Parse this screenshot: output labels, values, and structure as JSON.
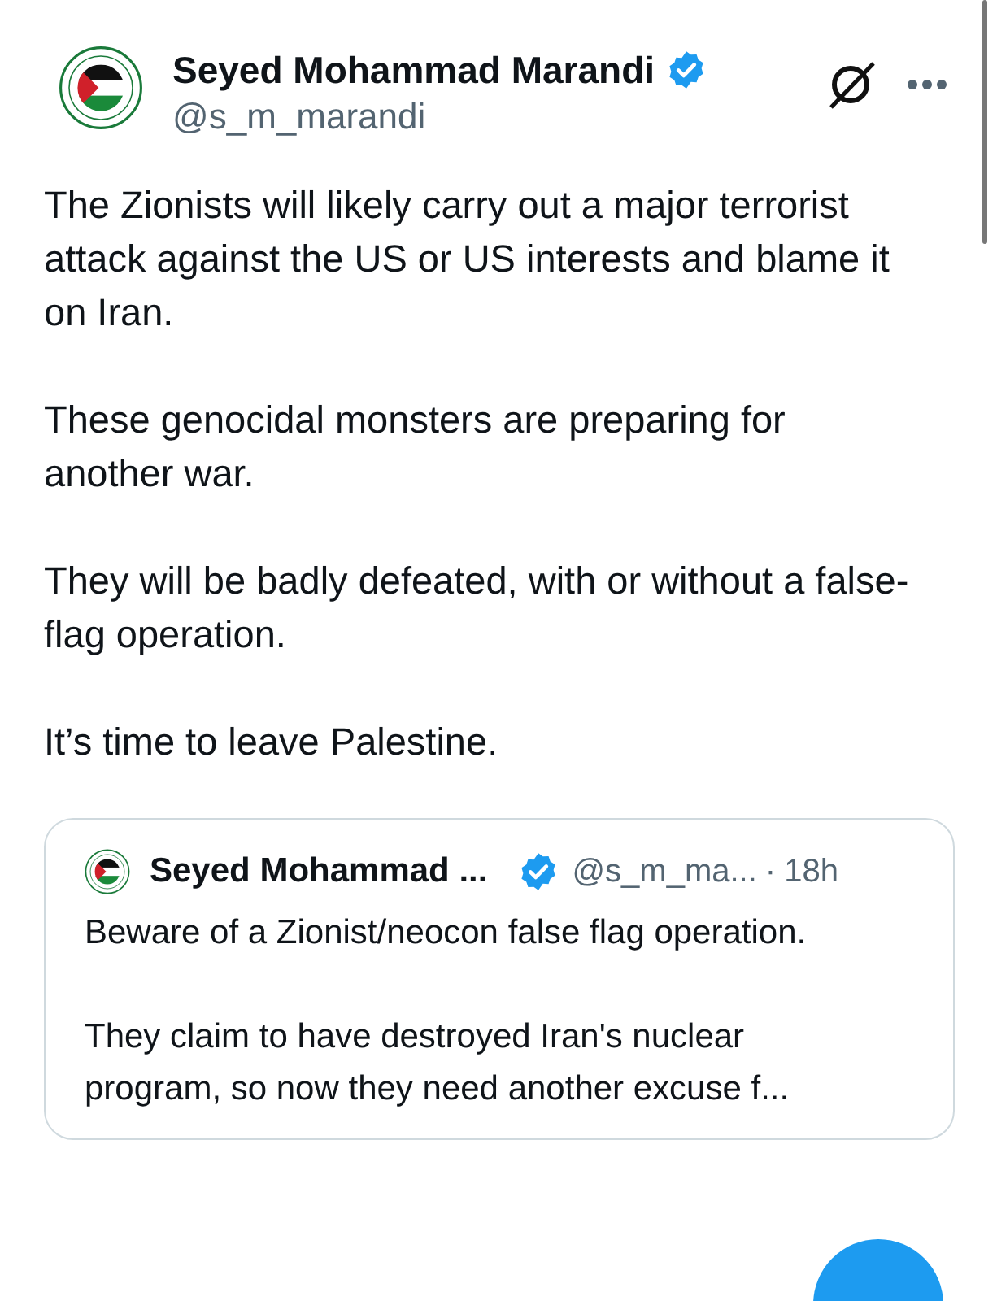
{
  "author": {
    "name": "Seyed Mohammad Marandi",
    "verified": true,
    "handle": "@s_m_marandi"
  },
  "paragraphs": [
    "The Zionists will likely carry out a major terrorist attack against the US or US interests and blame it on Iran.",
    "These genocidal monsters are preparing for another war.",
    "They will be badly defeated, with or without a false-flag operation.",
    "It’s time to leave Palestine."
  ],
  "quoted": {
    "name": "Seyed Mohammad ...",
    "verified": true,
    "handle": "@s_m_ma...",
    "separator": "·",
    "time": "18h",
    "paragraphs": [
      "Beware of a Zionist/neocon false flag operation.",
      "They claim to have destroyed Iran's nuclear program, so now they need another excuse f..."
    ]
  }
}
